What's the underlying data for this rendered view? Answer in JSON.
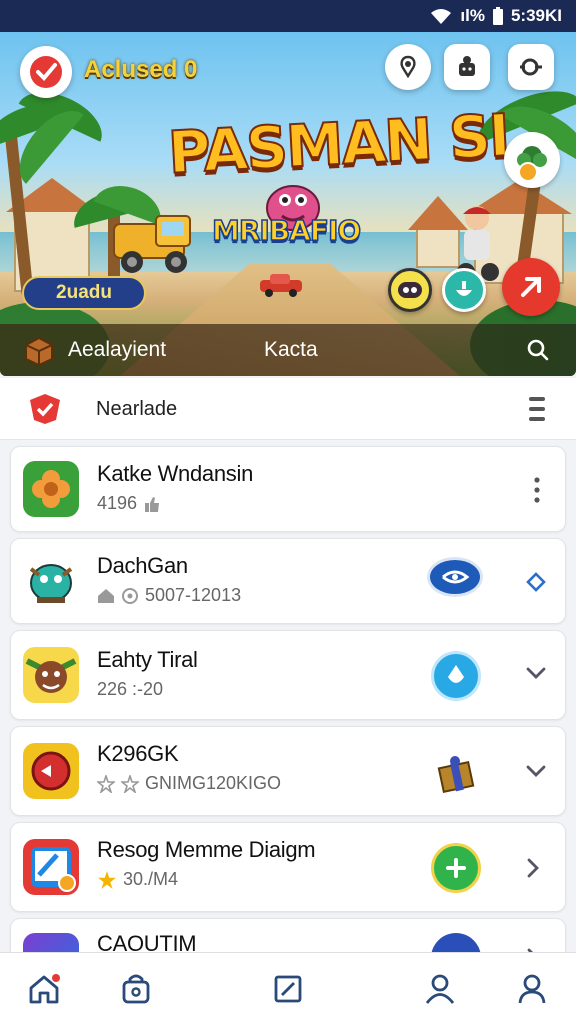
{
  "status_bar": {
    "time": "5:39KI",
    "battery_label": "ıl%",
    "icons": [
      "wifi-icon",
      "signal-icon",
      "battery-icon"
    ]
  },
  "hero": {
    "achievement_label": "Aclused 0",
    "title": "PASMAN SI",
    "subtitle": "MRIBAFIO",
    "pill_label": "2uadu",
    "bottom_tabs": [
      "Aealayient",
      "Kacta"
    ],
    "top_buttons": [
      "location-icon",
      "robot-icon",
      "search-link-icon"
    ],
    "colors": {
      "title": "#ffbd1f",
      "pill": "#233f8a",
      "action_red": "#e6392e"
    }
  },
  "section": {
    "title": "Nearlade"
  },
  "apps": [
    {
      "name": "Katke Wndansin",
      "meta": "4196"
    },
    {
      "name": "DachGan",
      "meta": "5007-12013"
    },
    {
      "name": "Eahty Tiral",
      "meta": "226 :-20"
    },
    {
      "name": "K296GK",
      "meta": "GNIMG120KIGO"
    },
    {
      "name": "Resog Memme Diaigm",
      "meta": "30./M4"
    },
    {
      "name": "CAOUTIM",
      "meta": ""
    }
  ],
  "bottom_nav": [
    "home-icon",
    "store-bag-icon",
    "edit-square-icon",
    "profile-icon",
    "account-icon"
  ]
}
